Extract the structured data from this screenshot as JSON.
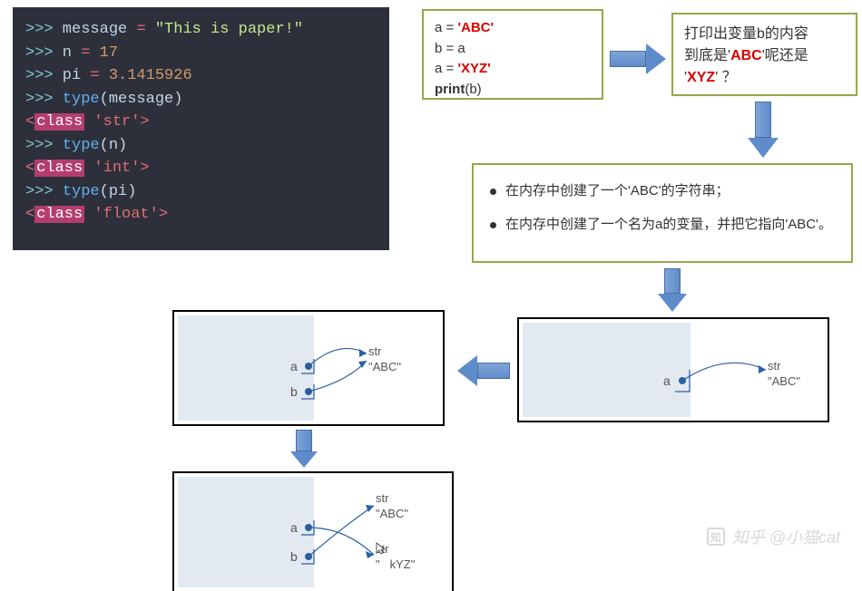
{
  "code": {
    "l1_prompt": ">>>",
    "l1_rest": " message ",
    "l1_eq": "=",
    "l1_str": " \"This is paper!\"",
    "l2_prompt": ">>>",
    "l2_rest": " n ",
    "l2_eq": "=",
    "l2_num": " 17",
    "l3_prompt": ">>>",
    "l3_rest": " pi ",
    "l3_eq": "=",
    "l3_num": " 3.1415926",
    "l4_prompt": ">>>",
    "l4_fn": " type",
    "l4_rest": "(message)",
    "l5_a": "<",
    "l5_cls": "class",
    "l5_b": " 'str'>",
    "l6_prompt": ">>>",
    "l6_fn": " type",
    "l6_rest": "(n)",
    "l7_a": "<",
    "l7_cls": "class",
    "l7_b": " 'int'>",
    "l8_prompt": ">>>",
    "l8_fn": " type",
    "l8_rest": "(pi)",
    "l9_a": "<",
    "l9_cls": "class",
    "l9_b": " 'float'>"
  },
  "snippet": {
    "l1a": "a = ",
    "l1b": "'ABC'",
    "l2": "b = a",
    "l3a": "a = ",
    "l3b": "'XYZ'",
    "l4a": "print",
    "l4b": "(b)"
  },
  "question": {
    "t1": "打印出变量b的内容",
    "t2a": "到底是'",
    "t2b": "ABC",
    "t2c": "'呢还是",
    "t3a": "'",
    "t3b": "XYZ",
    "t3c": "' ？"
  },
  "explain": {
    "b1": "在内存中创建了一个'ABC'的字符串；",
    "b2": "在内存中创建了一个名为a的变量，并把它指向'ABC'。"
  },
  "dia1": {
    "a": "a",
    "type": "str",
    "val": "\"ABC\""
  },
  "dia2": {
    "a": "a",
    "b": "b",
    "type": "str",
    "val": "\"ABC\""
  },
  "dia3": {
    "a": "a",
    "b": "b",
    "type1": "str",
    "val1": "\"ABC\"",
    "type2": "str",
    "val2_pre": "\"",
    "val2_cur": "kYZ\""
  },
  "watermark": "知乎 @小猫cat"
}
